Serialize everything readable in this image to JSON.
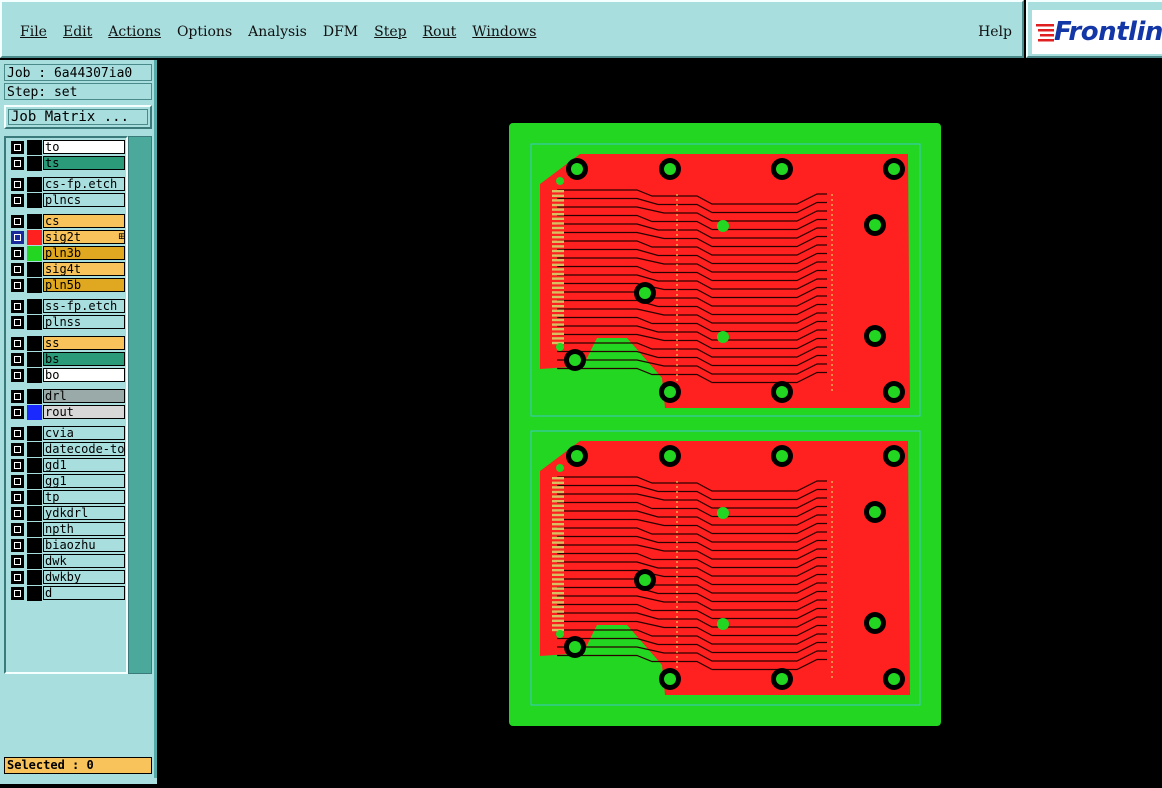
{
  "menu": {
    "items": [
      {
        "label": "File",
        "underline": true
      },
      {
        "label": "Edit",
        "underline": true
      },
      {
        "label": "Actions",
        "underline": true
      },
      {
        "label": "Options",
        "underline": false
      },
      {
        "label": "Analysis",
        "underline": false
      },
      {
        "label": "DFM",
        "underline": false
      },
      {
        "label": "Step",
        "underline": true
      },
      {
        "label": "Rout",
        "underline": true
      },
      {
        "label": "Windows",
        "underline": true
      }
    ],
    "help": "Help"
  },
  "logo": {
    "text": "Frontlin"
  },
  "job": {
    "label": "Job : 6a44307ia0"
  },
  "step": {
    "label": "Step: set"
  },
  "job_matrix_button": "Job Matrix ...",
  "layers": [
    {
      "name": "to",
      "bg": "bg-white",
      "swatch": "#000000",
      "sel": "#000000"
    },
    {
      "name": "ts",
      "bg": "bg-teal",
      "swatch": "#000000",
      "sel": "#000000"
    },
    {
      "name": "cs-fp.etch",
      "bg": "bg-cyan",
      "swatch": "#000000",
      "sel": "#000000",
      "gap": true
    },
    {
      "name": "plncs",
      "bg": "bg-cyan",
      "swatch": "#000000",
      "sel": "#000000"
    },
    {
      "name": "cs",
      "bg": "bg-orange",
      "swatch": "#000000",
      "sel": "#000000",
      "gap": true
    },
    {
      "name": "sig2t",
      "bg": "bg-orange",
      "swatch": "#ff2020",
      "sel": "#1a2a9a",
      "marker": true
    },
    {
      "name": "pln3b",
      "bg": "bg-amber",
      "swatch": "#22d622",
      "sel": "#000000"
    },
    {
      "name": "sig4t",
      "bg": "bg-orange",
      "swatch": "#000000",
      "sel": "#000000"
    },
    {
      "name": "pln5b",
      "bg": "bg-amber",
      "swatch": "#000000",
      "sel": "#000000"
    },
    {
      "name": "ss-fp.etch",
      "bg": "bg-cyan",
      "swatch": "#000000",
      "sel": "#000000",
      "gap": true
    },
    {
      "name": "plnss",
      "bg": "bg-cyan",
      "swatch": "#000000",
      "sel": "#000000"
    },
    {
      "name": "ss",
      "bg": "bg-orange",
      "swatch": "#000000",
      "sel": "#000000",
      "gap": true
    },
    {
      "name": "bs",
      "bg": "bg-teal",
      "swatch": "#000000",
      "sel": "#000000"
    },
    {
      "name": "bo",
      "bg": "bg-white",
      "swatch": "#000000",
      "sel": "#000000"
    },
    {
      "name": "drl",
      "bg": "bg-gray",
      "swatch": "#000000",
      "sel": "#000000",
      "gap": true
    },
    {
      "name": "rout",
      "bg": "bg-lightgray",
      "swatch": "#1a2aff",
      "sel": "#000000"
    },
    {
      "name": "cvia",
      "bg": "bg-cyan",
      "swatch": "#000000",
      "sel": "#000000",
      "gap": true
    },
    {
      "name": "datecode-to",
      "bg": "bg-cyan",
      "swatch": "#000000",
      "sel": "#000000"
    },
    {
      "name": "gd1",
      "bg": "bg-cyan",
      "swatch": "#000000",
      "sel": "#000000"
    },
    {
      "name": "gg1",
      "bg": "bg-cyan",
      "swatch": "#000000",
      "sel": "#000000"
    },
    {
      "name": "tp",
      "bg": "bg-cyan",
      "swatch": "#000000",
      "sel": "#000000"
    },
    {
      "name": "ydkdrl",
      "bg": "bg-cyan",
      "swatch": "#000000",
      "sel": "#000000"
    },
    {
      "name": "npth",
      "bg": "bg-cyan",
      "swatch": "#000000",
      "sel": "#000000"
    },
    {
      "name": "biaozhu",
      "bg": "bg-cyan",
      "swatch": "#000000",
      "sel": "#000000"
    },
    {
      "name": "dwk",
      "bg": "bg-cyan",
      "swatch": "#000000",
      "sel": "#000000"
    },
    {
      "name": "dwkby",
      "bg": "bg-cyan",
      "swatch": "#000000",
      "sel": "#000000"
    },
    {
      "name": "d",
      "bg": "bg-cyan",
      "swatch": "#000000",
      "sel": "#000000"
    }
  ],
  "selected": "Selected : 0",
  "colors": {
    "panel": "#a8dede",
    "copper": "#ff2020",
    "plane": "#22d622",
    "board_outline": "#40c8c8"
  }
}
